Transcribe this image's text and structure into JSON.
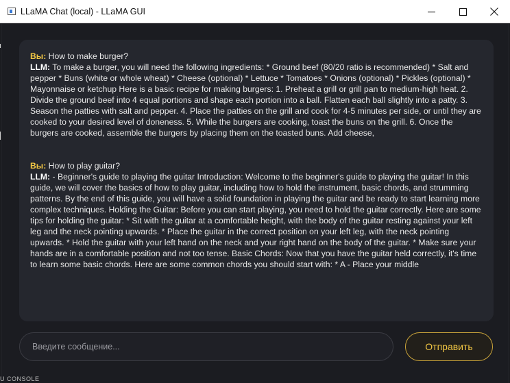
{
  "window": {
    "title": "LLaMA Chat (local) - LLaMA GUI",
    "icon": "chat-window-icon",
    "controls": {
      "minimize": "minimize-icon",
      "maximize": "maximize-icon",
      "close": "close-icon"
    }
  },
  "chat": {
    "messages": [
      {
        "user_label": "Вы:",
        "user_text": "How to make burger?",
        "llm_label": "LLM:",
        "llm_text": "To make a burger, you will need the following ingredients: * Ground beef (80/20 ratio is recommended) * Salt and pepper * Buns (white or whole wheat) * Cheese (optional) * Lettuce * Tomatoes * Onions (optional) * Pickles (optional) * Mayonnaise or ketchup Here is a basic recipe for making burgers: 1. Preheat a grill or grill pan to medium-high heat. 2. Divide the ground beef into 4 equal portions and shape each portion into a ball. Flatten each ball slightly into a patty. 3. Season the patties with salt and pepper. 4. Place the patties on the grill and cook for 4-5 minutes per side, or until they are cooked to your desired level of doneness. 5. While the burgers are cooking, toast the buns on the grill. 6. Once the burgers are cooked, assemble the burgers by placing them on the toasted buns. Add cheese,"
      },
      {
        "user_label": "Вы:",
        "user_text": "How to play guitar?",
        "llm_label": "LLM:",
        "llm_text": "- Beginner's guide to playing the guitar Introduction: Welcome to the beginner's guide to playing the guitar! In this guide, we will cover the basics of how to play guitar, including how to hold the instrument, basic chords, and strumming patterns. By the end of this guide, you will have a solid foundation in playing the guitar and be ready to start learning more complex techniques. Holding the Guitar: Before you can start playing, you need to hold the guitar correctly. Here are some tips for holding the guitar: * Sit with the guitar at a comfortable height, with the body of the guitar resting against your left leg and the neck pointing upwards. * Place the guitar in the correct position on your left leg, with the neck pointing upwards. * Hold the guitar with your left hand on the neck and your right hand on the body of the guitar. * Make sure your hands are in a comfortable position and not too tense. Basic Chords: Now that you have the guitar held correctly, it's time to learn some basic chords. Here are some common chords you should start with: * A - Place your middle"
      }
    ]
  },
  "composer": {
    "placeholder": "Введите сообщение...",
    "value": "",
    "send_label": "Отправить"
  },
  "background": {
    "bottom_left_text": "U CONSOLE"
  },
  "colors": {
    "accent": "#f2c744",
    "background": "#1b1c21",
    "panel": "#25272e",
    "text": "#e7e7e7"
  }
}
